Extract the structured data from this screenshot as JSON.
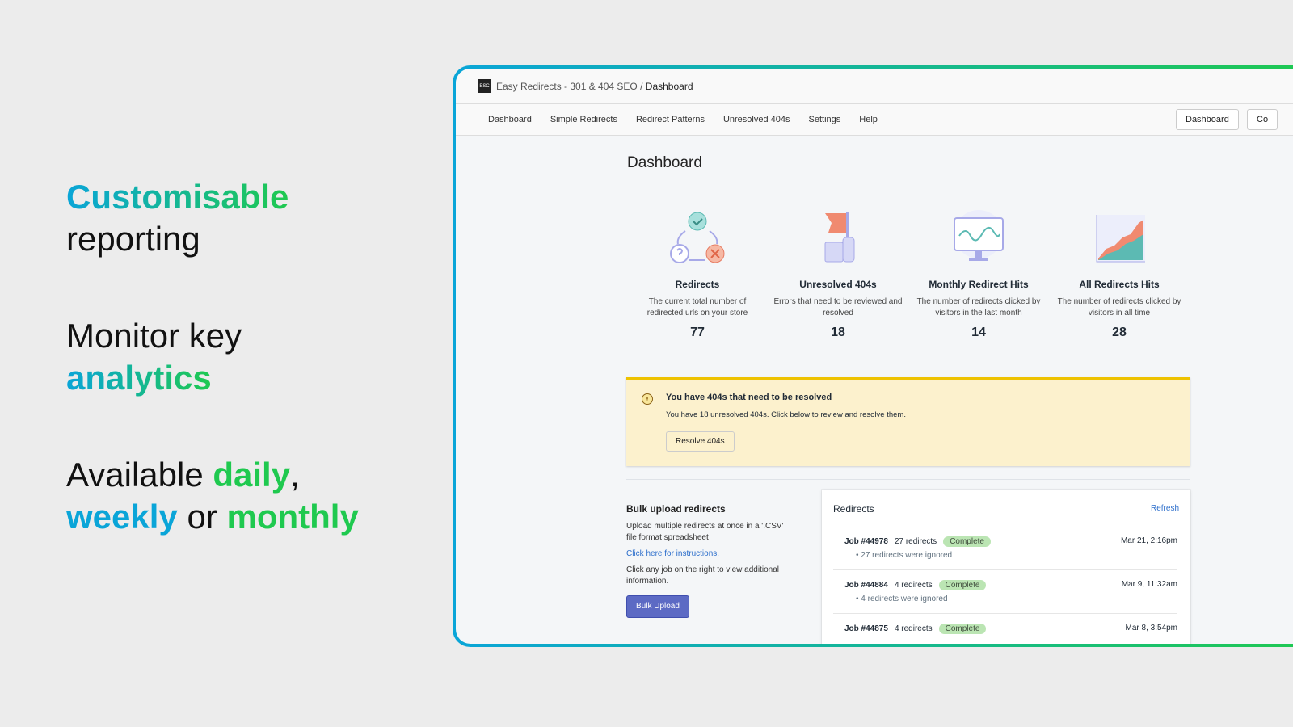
{
  "tagline": {
    "l1a": "Customisable",
    "l1b": "reporting",
    "l2a": "Monitor key",
    "l2b": "analytics",
    "l3a": "Available",
    "l3b": "daily",
    "l3comma": ",",
    "l3c": "weekly",
    "l3d": "or",
    "l3e": "monthly"
  },
  "app": {
    "logo": "ESC",
    "name": "Easy Redirects - 301 & 404 SEO",
    "sep": "/",
    "page": "Dashboard"
  },
  "nav": [
    "Dashboard",
    "Simple Redirects",
    "Redirect Patterns",
    "Unresolved 404s",
    "Settings",
    "Help"
  ],
  "nav_buttons": [
    "Dashboard",
    "Co"
  ],
  "title": "Dashboard",
  "stats": [
    {
      "title": "Redirects",
      "desc": "The current total number of redirected urls on your store",
      "value": "77"
    },
    {
      "title": "Unresolved 404s",
      "desc": "Errors that need to be reviewed and resolved",
      "value": "18"
    },
    {
      "title": "Monthly Redirect Hits",
      "desc": "The number of redirects clicked by visitors in the last month",
      "value": "14"
    },
    {
      "title": "All Redirects Hits",
      "desc": "The number of redirects clicked by visitors in all time",
      "value": "28"
    }
  ],
  "banner": {
    "title": "You have 404s that need to be resolved",
    "body": "You have 18 unresolved 404s. Click below to review and resolve them.",
    "button": "Resolve 404s"
  },
  "bulk": {
    "title": "Bulk upload redirects",
    "desc": "Upload multiple redirects at once in a '.CSV' file format spreadsheet",
    "link": "Click here for instructions.",
    "hint": "Click any job on the right to view additional information.",
    "button": "Bulk Upload"
  },
  "redirects": {
    "title": "Redirects",
    "refresh": "Refresh",
    "jobs": [
      {
        "job": "Job #44978",
        "count": "27 redirects",
        "status": "Complete",
        "note": "27 redirects were ignored",
        "date": "Mar 21, 2:16pm"
      },
      {
        "job": "Job #44884",
        "count": "4 redirects",
        "status": "Complete",
        "note": "4 redirects were ignored",
        "date": "Mar 9, 11:32am"
      },
      {
        "job": "Job #44875",
        "count": "4 redirects",
        "status": "Complete",
        "note": "",
        "date": "Mar 8, 3:54pm"
      }
    ]
  }
}
